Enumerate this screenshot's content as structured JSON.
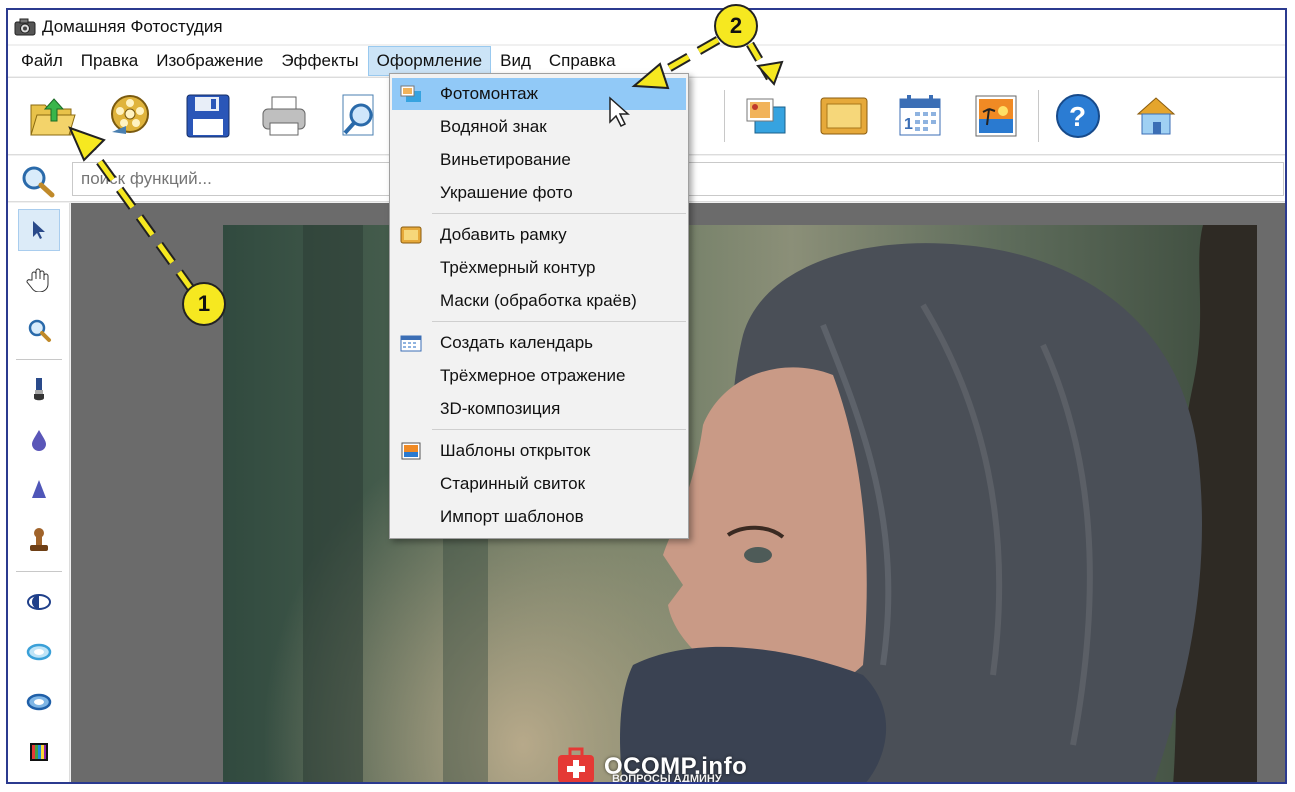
{
  "window": {
    "title": "Домашняя Фотостудия",
    "app_icon": "camera-icon"
  },
  "menubar": {
    "items": [
      {
        "label": "Файл"
      },
      {
        "label": "Правка"
      },
      {
        "label": "Изображение"
      },
      {
        "label": "Эффекты"
      },
      {
        "label": "Оформление",
        "active": true
      },
      {
        "label": "Вид"
      },
      {
        "label": "Справка"
      }
    ]
  },
  "toolbar": {
    "buttons": [
      "open-folder-icon",
      "film-reel-icon",
      "save-floppy-icon",
      "print-icon",
      "preview-icon",
      "photomontage-icon",
      "frame-icon",
      "calendar-icon",
      "postcard-icon",
      "help-icon",
      "home-icon"
    ]
  },
  "search": {
    "placeholder": "поиск функций...",
    "icon": "magnifier-icon"
  },
  "left_tools": [
    "pointer-icon",
    "hand-icon",
    "zoom-icon",
    "brush-icon",
    "drop-icon",
    "sharpen-icon",
    "stamp-icon",
    "eye-dark-icon",
    "eye-light-icon",
    "eye-outline-icon",
    "color-bars-icon"
  ],
  "dropdown": {
    "items": [
      {
        "label": "Фотомонтаж",
        "icon": "photomontage-icon",
        "highlighted": true
      },
      {
        "label": "Водяной знак"
      },
      {
        "label": "Виньетирование"
      },
      {
        "label": "Украшение фото"
      },
      {
        "label": "Добавить рамку",
        "icon": "frame-icon"
      },
      {
        "label": "Трёхмерный контур"
      },
      {
        "label": "Маски (обработка краёв)"
      },
      {
        "label": "Создать календарь",
        "icon": "calendar-icon"
      },
      {
        "label": "Трёхмерное отражение"
      },
      {
        "label": "3D-композиция"
      },
      {
        "label": "Шаблоны открыток",
        "icon": "postcard-icon"
      },
      {
        "label": "Старинный свиток"
      },
      {
        "label": "Импорт шаблонов"
      }
    ]
  },
  "annotations": {
    "badge1": "1",
    "badge2": "2",
    "badge_color": "#f6e820"
  },
  "watermark": {
    "text": "OCOMP.info",
    "subtext": "ВОПРОСЫ АДМИНУ"
  },
  "colors": {
    "frame_border": "#2b3a8f",
    "menu_active": "#cce4f7",
    "dropdown_highlight": "#91c9f7"
  }
}
